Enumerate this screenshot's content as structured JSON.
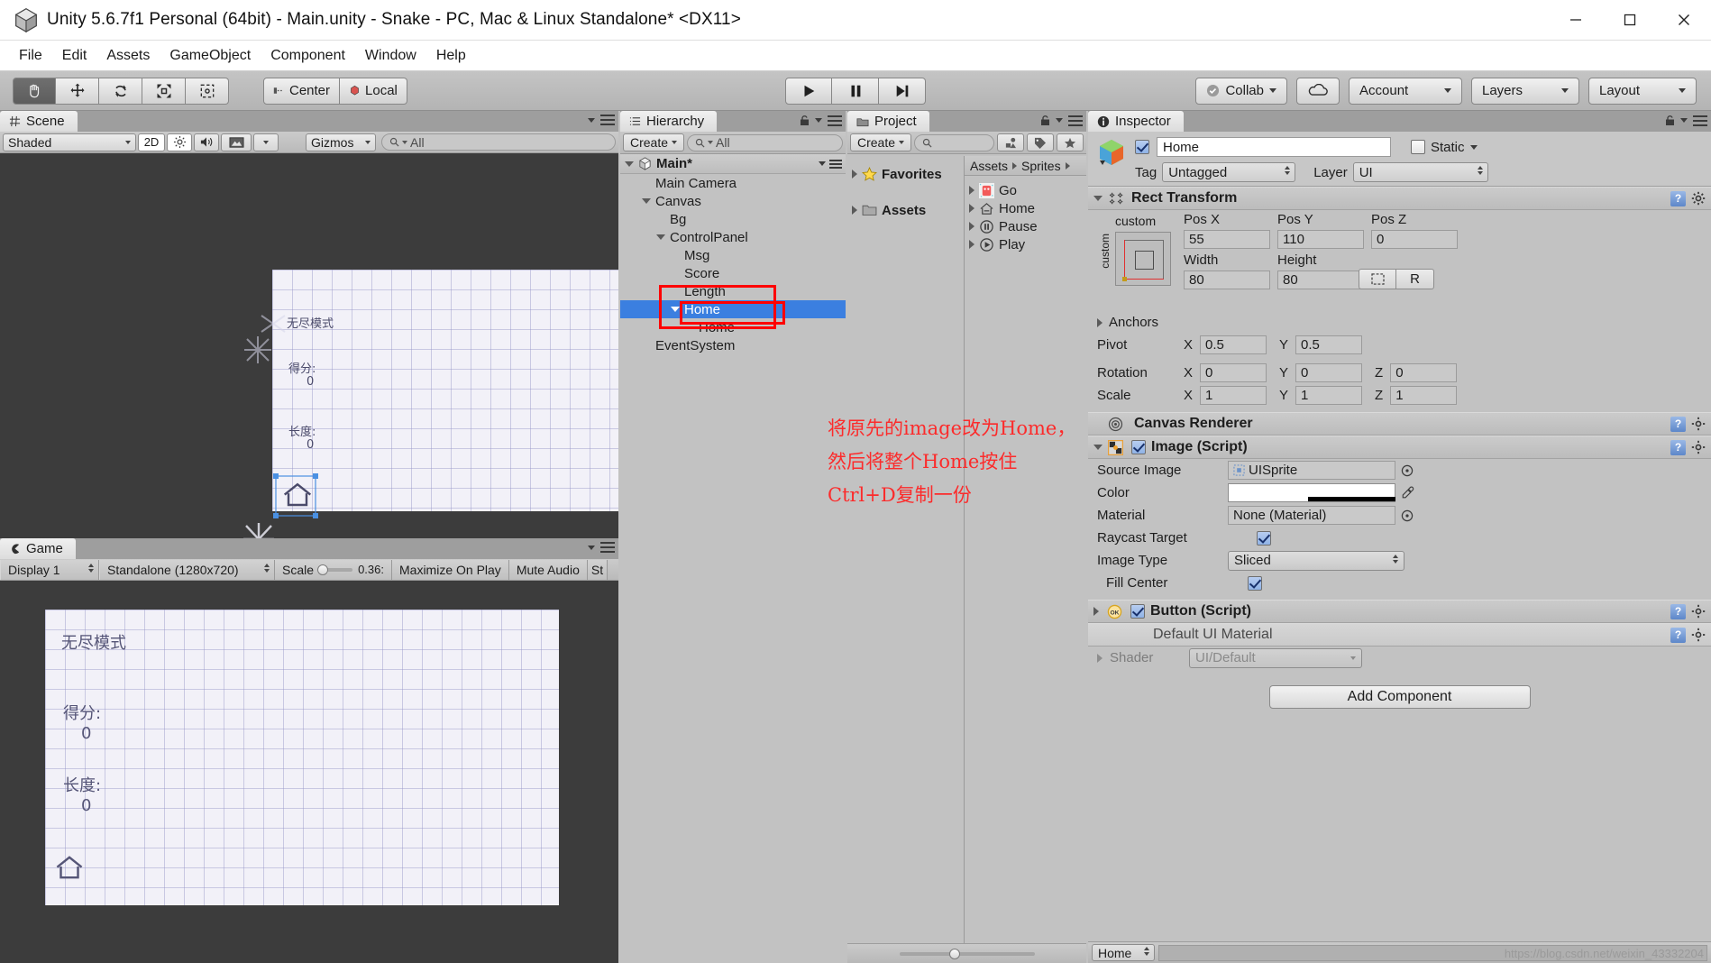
{
  "window": {
    "title": "Unity 5.6.7f1 Personal (64bit) - Main.unity - Snake - PC, Mac & Linux Standalone* <DX11>",
    "minimize": "minimize-icon",
    "maximize": "maximize-icon",
    "close": "close-icon"
  },
  "menubar": {
    "items": [
      "File",
      "Edit",
      "Assets",
      "GameObject",
      "Component",
      "Window",
      "Help"
    ]
  },
  "toolbar": {
    "transform_tools": [
      "hand-tool",
      "move-tool",
      "rotate-tool",
      "scale-tool",
      "rect-tool"
    ],
    "pivot_mode": "Center",
    "pivot_rotation": "Local",
    "play": "play-button",
    "pause": "pause-button",
    "step": "step-button",
    "collab": "Collab",
    "cloud": "cloud-icon",
    "account": "Account",
    "layers": "Layers",
    "layout": "Layout"
  },
  "scene": {
    "tab": "Scene",
    "draw_mode": "Shaded",
    "mode_2d": "2D",
    "lighting": "lighting-icon",
    "audio": "audio-icon",
    "fx": "fx-icon",
    "gizmos": "Gizmos",
    "search_placeholder": "All",
    "game_overlay": {
      "mode_label": "无尽模式",
      "score_label": "得分:",
      "score_value": "0",
      "length_label": "长度:",
      "length_value": "0"
    }
  },
  "game": {
    "tab": "Game",
    "display": "Display 1",
    "aspect": "Standalone (1280x720)",
    "scale_label": "Scale",
    "scale_value": "0.36:",
    "maximize": "Maximize On Play",
    "mute": "Mute Audio",
    "stats": "St",
    "overlay": {
      "mode_label": "无尽模式",
      "score_label": "得分:",
      "score_value": "0",
      "length_label": "长度:",
      "length_value": "0"
    }
  },
  "hierarchy": {
    "tab": "Hierarchy",
    "create": "Create",
    "search_placeholder": "All",
    "scene_name": "Main*",
    "items": [
      {
        "label": "Main Camera",
        "depth": 1,
        "arrow": "none",
        "selected": false
      },
      {
        "label": "Canvas",
        "depth": 1,
        "arrow": "open",
        "selected": false
      },
      {
        "label": "Bg",
        "depth": 2,
        "arrow": "none",
        "selected": false
      },
      {
        "label": "ControlPanel",
        "depth": 2,
        "arrow": "open",
        "selected": false
      },
      {
        "label": "Msg",
        "depth": 3,
        "arrow": "none",
        "selected": false
      },
      {
        "label": "Score",
        "depth": 3,
        "arrow": "none",
        "selected": false
      },
      {
        "label": "Length",
        "depth": 3,
        "arrow": "none",
        "selected": false
      },
      {
        "label": "Home",
        "depth": 3,
        "arrow": "open",
        "selected": true
      },
      {
        "label": "Home",
        "depth": 4,
        "arrow": "none",
        "selected": false
      },
      {
        "label": "EventSystem",
        "depth": 1,
        "arrow": "none",
        "selected": false
      }
    ]
  },
  "project": {
    "tab": "Project",
    "create": "Create",
    "search_placeholder": "",
    "tree": [
      {
        "label": "Favorites",
        "icon": "star-icon"
      },
      {
        "label": "Assets",
        "icon": "folder-icon"
      }
    ],
    "breadcrumb": [
      "Assets",
      "Sprites"
    ],
    "assets": [
      {
        "label": "Go",
        "icon": "sprite-go-icon"
      },
      {
        "label": "Home",
        "icon": "sprite-home-icon"
      },
      {
        "label": "Pause",
        "icon": "sprite-pause-icon"
      },
      {
        "label": "Play",
        "icon": "sprite-play-icon"
      }
    ]
  },
  "inspector": {
    "tab": "Inspector",
    "object_name": "Home",
    "enabled": true,
    "static_label": "Static",
    "tag_label": "Tag",
    "tag_value": "Untagged",
    "layer_label": "Layer",
    "layer_value": "UI",
    "rect_transform": {
      "title": "Rect Transform",
      "anchor_preset": "custom",
      "anchor_preset_v": "custom",
      "pos_x_label": "Pos X",
      "pos_x": "55",
      "pos_y_label": "Pos Y",
      "pos_y": "110",
      "pos_z_label": "Pos Z",
      "pos_z": "0",
      "width_label": "Width",
      "width": "80",
      "height_label": "Height",
      "height": "80",
      "blueprint_btn": "blueprint-icon",
      "raw_btn": "R",
      "anchors_label": "Anchors",
      "pivot_label": "Pivot",
      "pivot_x": "0.5",
      "pivot_y": "0.5",
      "rotation_label": "Rotation",
      "rot_x": "0",
      "rot_y": "0",
      "rot_z": "0",
      "scale_label": "Scale",
      "scale_x": "1",
      "scale_y": "1",
      "scale_z": "1"
    },
    "canvas_renderer": {
      "title": "Canvas Renderer"
    },
    "image_script": {
      "title": "Image (Script)",
      "enabled": true,
      "source_image_label": "Source Image",
      "source_image": "UISprite",
      "color_label": "Color",
      "color_value": "#FFFFFF",
      "material_label": "Material",
      "material_value": "None (Material)",
      "raycast_label": "Raycast Target",
      "raycast_on": true,
      "image_type_label": "Image Type",
      "image_type": "Sliced",
      "fill_center_label": "Fill Center",
      "fill_center_on": true
    },
    "button_script": {
      "title": "Button (Script)",
      "enabled": true
    },
    "material": {
      "title": "Default UI Material",
      "shader_label": "Shader",
      "shader_value": "UI/Default"
    },
    "add_component": "Add Component",
    "footer_name": "Home"
  },
  "annotation": {
    "line1": "将原先的image改为Home，",
    "line2": "然后将整个Home按住",
    "line3": "Ctrl+D复制一份"
  },
  "watermark": "https://blog.csdn.net/weixin_43332204",
  "colors": {
    "selection_blue": "#3b7fe0",
    "annotation_red": "#fc2b2b",
    "highlight_box_red": "#ff0000",
    "panel_gray": "#c2c2c2"
  }
}
